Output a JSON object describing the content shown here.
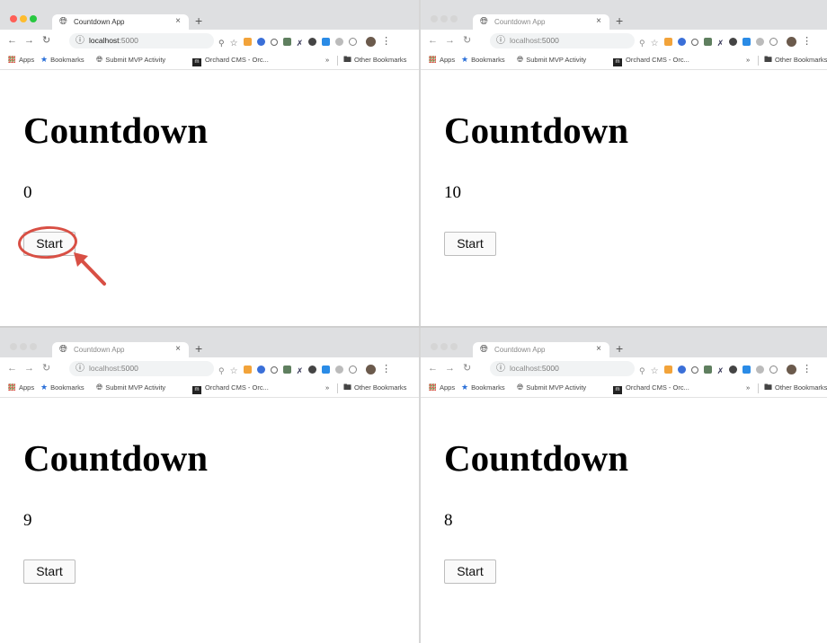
{
  "palette": {
    "light_red": "#ff5f57",
    "light_yellow": "#febc2e",
    "light_green": "#28c840",
    "annotation_red": "#d84f44"
  },
  "panels": [
    {
      "active": true,
      "tab": {
        "favicon": "globe-icon",
        "title": "Countdown App",
        "close": "×"
      },
      "new_tab": "+",
      "url": {
        "host": "localhost",
        "port": ":5000"
      },
      "bookmarks": {
        "apps": "Apps",
        "bookmarks": "Bookmarks",
        "submit": "Submit MVP Activity",
        "orchard": "Orchard CMS - Orc...",
        "more": "»",
        "other": "Other Bookmarks"
      },
      "heading": "Countdown",
      "count": "0",
      "button_label": "Start",
      "highlight_start": true
    },
    {
      "active": false,
      "tab": {
        "favicon": "globe-icon",
        "title": "Countdown App",
        "close": "×"
      },
      "new_tab": "+",
      "url": {
        "host": "localhost",
        "port": ":5000"
      },
      "bookmarks": {
        "apps": "Apps",
        "bookmarks": "Bookmarks",
        "submit": "Submit MVP Activity",
        "orchard": "Orchard CMS - Orc...",
        "more": "»",
        "other": "Other Bookmarks"
      },
      "heading": "Countdown",
      "count": "10",
      "button_label": "Start",
      "highlight_start": false
    },
    {
      "active": false,
      "tab": {
        "favicon": "globe-icon",
        "title": "Countdown App",
        "close": "×"
      },
      "new_tab": "+",
      "url": {
        "host": "localhost",
        "port": ":5000"
      },
      "bookmarks": {
        "apps": "Apps",
        "bookmarks": "Bookmarks",
        "submit": "Submit MVP Activity",
        "orchard": "Orchard CMS - Orc...",
        "more": "»",
        "other": "Other Bookmarks"
      },
      "heading": "Countdown",
      "count": "9",
      "button_label": "Start",
      "highlight_start": false
    },
    {
      "active": false,
      "tab": {
        "favicon": "globe-icon",
        "title": "Countdown App",
        "close": "×"
      },
      "new_tab": "+",
      "url": {
        "host": "localhost",
        "port": ":5000"
      },
      "bookmarks": {
        "apps": "Apps",
        "bookmarks": "Bookmarks",
        "submit": "Submit MVP Activity",
        "orchard": "Orchard CMS - Orc...",
        "more": "»",
        "other": "Other Bookmarks"
      },
      "heading": "Countdown",
      "count": "8",
      "button_label": "Start",
      "highlight_start": false
    }
  ]
}
